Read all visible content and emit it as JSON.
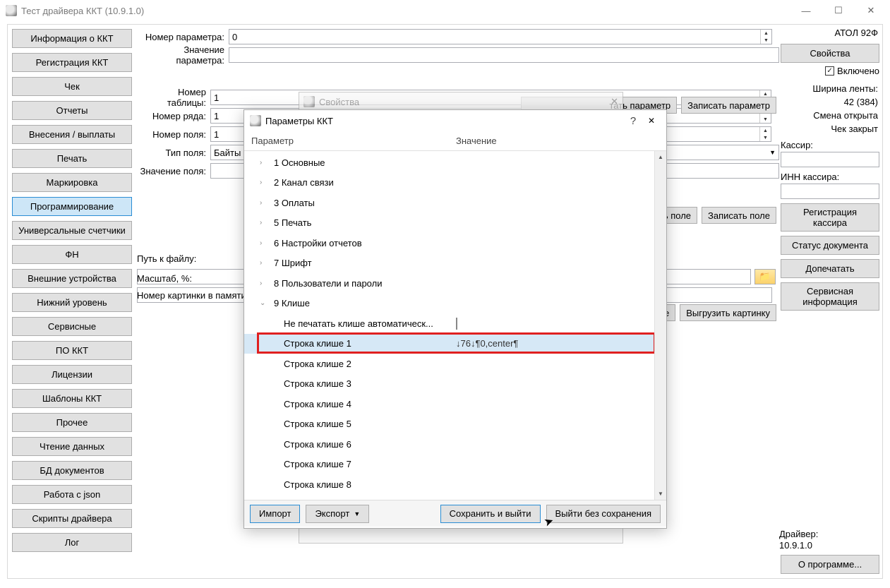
{
  "window": {
    "title": "Тест драйвера ККТ (10.9.1.0)"
  },
  "sidebar": {
    "items": [
      "Информация о ККТ",
      "Регистрация ККТ",
      "Чек",
      "Отчеты",
      "Внесения / выплаты",
      "Печать",
      "Маркировка",
      "Программирование",
      "Универсальные счетчики",
      "ФН",
      "Внешние устройства",
      "Нижний уровень",
      "Сервисные",
      "ПО ККТ",
      "Лицензии",
      "Шаблоны ККТ",
      "Прочее",
      "Чтение данных",
      "БД документов",
      "Работа с json",
      "Скрипты драйвера",
      "Лог"
    ],
    "active_index": 7
  },
  "center": {
    "param_number_label": "Номер параметра:",
    "param_number_value": "0",
    "param_value_label": "Значение параметра:",
    "param_value_value": "",
    "read_param_btn": "Прочитать параметр",
    "write_param_btn": "Записать параметр",
    "table_number_label": "Номер таблицы:",
    "table_number_value": "1",
    "row_number_label": "Номер ряда:",
    "row_number_value": "1",
    "field_number_label": "Номер поля:",
    "field_number_value": "1",
    "field_type_label": "Тип поля:",
    "field_type_value": "Байты",
    "field_value_label": "Значение поля:",
    "field_value_value": "",
    "read_field_btn": "Прочитать поле",
    "write_field_btn": "Записать поле",
    "file_path_label": "Путь к файлу:",
    "scale_label": "Масштаб, %:",
    "pic_number_label": "Номер картинки в памяти:",
    "klishe_btn1": "Записать клише",
    "klishe_btn2": "Выгрузить картинку"
  },
  "right": {
    "device_name": "АТОЛ 92Ф",
    "properties_btn": "Свойства",
    "enabled_chk": "Включено",
    "tape_width_label": "Ширина ленты:",
    "tape_width_value": "42 (384)",
    "shift_open": "Смена открыта",
    "check_closed": "Чек закрыт",
    "cashier_label": "Кассир:",
    "cashier_inn_label": "ИНН кассира:",
    "cashier_reg_btn_l1": "Регистрация",
    "cashier_reg_btn_l2": "кассира",
    "doc_status_btn": "Статус документа",
    "reprint_btn": "Допечатать",
    "service_info_btn_l1": "Сервисная",
    "service_info_btn_l2": "информация",
    "driver_label": "Драйвер:",
    "driver_version": "10.9.1.0",
    "about_btn": "О программе..."
  },
  "modal_behind": {
    "title": "Свойства"
  },
  "modal": {
    "title": "Параметры ККТ",
    "col_param": "Параметр",
    "col_value": "Значение",
    "groups": [
      "1 Основные",
      "2 Канал связи",
      "3 Оплаты",
      "5 Печать",
      "6 Настройки отчетов",
      "7 Шрифт",
      "8 Пользователи и пароли",
      "9 Клише"
    ],
    "sub_no_auto": "Не печатать клише автоматическ...",
    "cliche_rows": [
      "Строка клише 1",
      "Строка клише 2",
      "Строка клише 3",
      "Строка клише 4",
      "Строка клише 5",
      "Строка клише 6",
      "Строка клише 7",
      "Строка клише 8"
    ],
    "cliche1_value": "↓76↓¶0,center¶",
    "import_btn": "Импорт",
    "export_btn": "Экспорт",
    "save_exit_btn": "Сохранить и выйти",
    "exit_nosave_btn": "Выйти без сохранения"
  }
}
